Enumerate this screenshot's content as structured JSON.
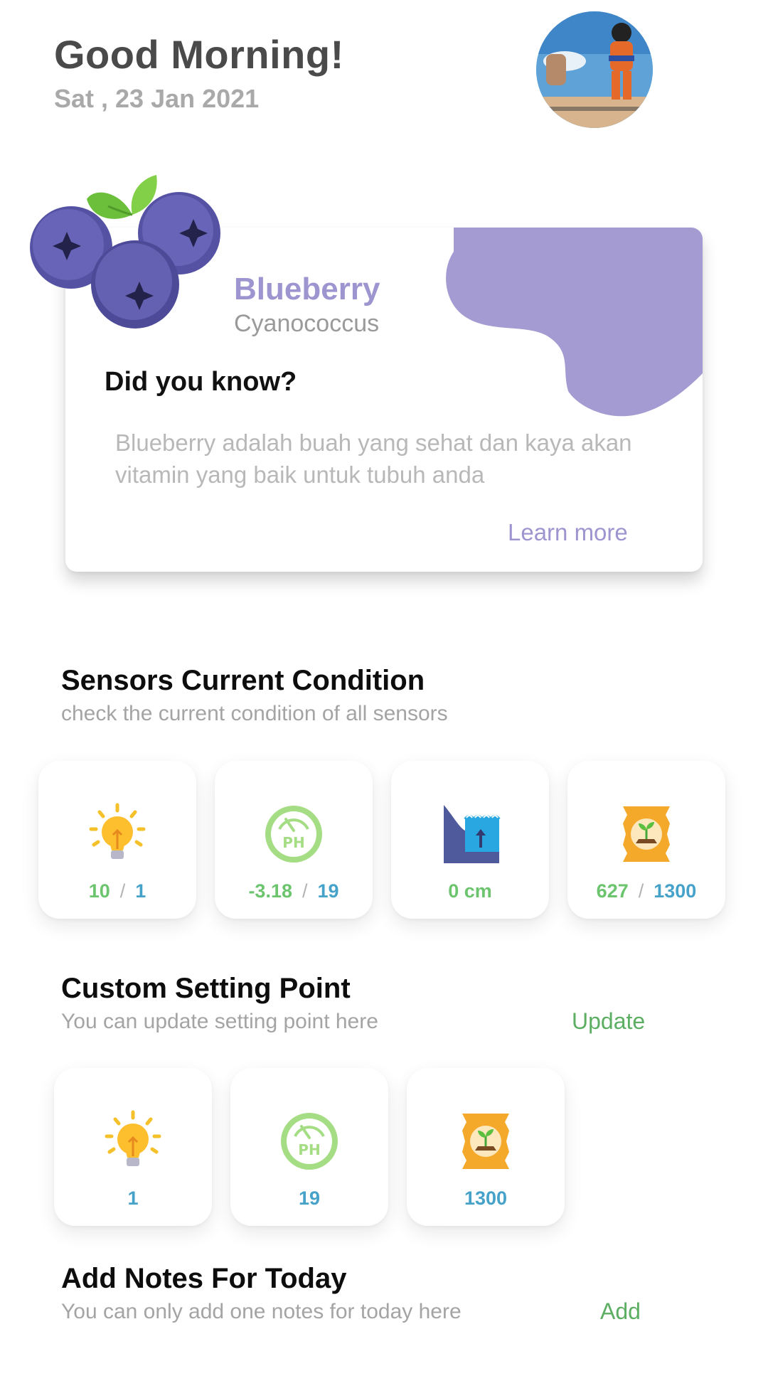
{
  "header": {
    "greeting": "Good Morning!",
    "date": "Sat , 23 Jan 2021"
  },
  "plant_card": {
    "name": "Blueberry",
    "latin_name": "Cyanococcus",
    "fact_heading": "Did you know?",
    "fact_text": "Blueberry adalah buah yang sehat dan kaya akan vitamin yang baik untuk tubuh anda",
    "learn_more_label": "Learn more",
    "accent_color": "#9d95cf"
  },
  "sensors": {
    "title": "Sensors Current Condition",
    "subtitle": "check the current condition of all sensors",
    "items": [
      {
        "icon": "light-bulb-icon",
        "current": "10",
        "separator": "/",
        "setpoint": "1"
      },
      {
        "icon": "ph-meter-icon",
        "current": "-3.18",
        "separator": "/",
        "setpoint": "19"
      },
      {
        "icon": "water-level-icon",
        "current": "0 cm"
      },
      {
        "icon": "soil-bag-icon",
        "current": "627",
        "separator": "/",
        "setpoint": "1300"
      }
    ]
  },
  "setting_point": {
    "title": "Custom Setting Point",
    "subtitle": "You can update setting point here",
    "action_label": "Update",
    "items": [
      {
        "icon": "light-bulb-icon",
        "value": "1"
      },
      {
        "icon": "ph-meter-icon",
        "value": "19"
      },
      {
        "icon": "soil-bag-icon",
        "value": "1300"
      }
    ]
  },
  "notes": {
    "title": "Add Notes For Today",
    "subtitle": "You can only add one notes for today here",
    "action_label": "Add"
  },
  "colors": {
    "current_value": "#6cc46e",
    "setpoint_value": "#46a2c9",
    "action": "#5cae62"
  }
}
